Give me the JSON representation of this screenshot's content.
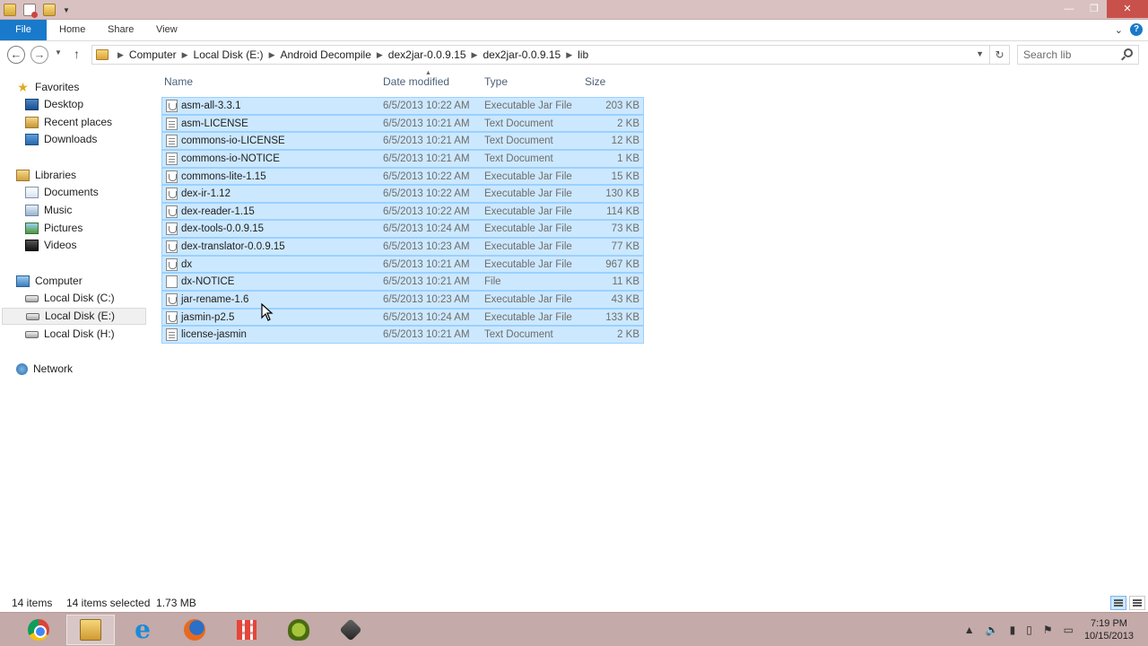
{
  "ribbon": {
    "tabs": [
      "File",
      "Home",
      "Share",
      "View"
    ],
    "accent": "#1979ca"
  },
  "address": {
    "crumbs": [
      "Computer",
      "Local Disk (E:)",
      "Android Decompile",
      "dex2jar-0.0.9.15",
      "dex2jar-0.0.9.15",
      "lib"
    ],
    "search_placeholder": "Search lib"
  },
  "sidebar": {
    "favorites": {
      "label": "Favorites",
      "items": [
        "Desktop",
        "Recent places",
        "Downloads"
      ]
    },
    "libraries": {
      "label": "Libraries",
      "items": [
        "Documents",
        "Music",
        "Pictures",
        "Videos"
      ]
    },
    "computer": {
      "label": "Computer",
      "items": [
        "Local Disk (C:)",
        "Local Disk (E:)",
        "Local Disk (H:)"
      ],
      "selected": "Local Disk (E:)"
    },
    "network": {
      "label": "Network"
    }
  },
  "columns": {
    "name": "Name",
    "date": "Date modified",
    "type": "Type",
    "size": "Size"
  },
  "files": [
    {
      "name": "asm-all-3.3.1",
      "date": "6/5/2013 10:22 AM",
      "type": "Executable Jar File",
      "size": "203 KB",
      "icon": "jar-file-icon"
    },
    {
      "name": "asm-LICENSE",
      "date": "6/5/2013 10:21 AM",
      "type": "Text Document",
      "size": "2 KB",
      "icon": "text-file-icon"
    },
    {
      "name": "commons-io-LICENSE",
      "date": "6/5/2013 10:21 AM",
      "type": "Text Document",
      "size": "12 KB",
      "icon": "text-file-icon"
    },
    {
      "name": "commons-io-NOTICE",
      "date": "6/5/2013 10:21 AM",
      "type": "Text Document",
      "size": "1 KB",
      "icon": "text-file-icon"
    },
    {
      "name": "commons-lite-1.15",
      "date": "6/5/2013 10:22 AM",
      "type": "Executable Jar File",
      "size": "15 KB",
      "icon": "jar-file-icon"
    },
    {
      "name": "dex-ir-1.12",
      "date": "6/5/2013 10:22 AM",
      "type": "Executable Jar File",
      "size": "130 KB",
      "icon": "jar-file-icon"
    },
    {
      "name": "dex-reader-1.15",
      "date": "6/5/2013 10:22 AM",
      "type": "Executable Jar File",
      "size": "114 KB",
      "icon": "jar-file-icon"
    },
    {
      "name": "dex-tools-0.0.9.15",
      "date": "6/5/2013 10:24 AM",
      "type": "Executable Jar File",
      "size": "73 KB",
      "icon": "jar-file-icon"
    },
    {
      "name": "dex-translator-0.0.9.15",
      "date": "6/5/2013 10:23 AM",
      "type": "Executable Jar File",
      "size": "77 KB",
      "icon": "jar-file-icon"
    },
    {
      "name": "dx",
      "date": "6/5/2013 10:21 AM",
      "type": "Executable Jar File",
      "size": "967 KB",
      "icon": "jar-file-icon"
    },
    {
      "name": "dx-NOTICE",
      "date": "6/5/2013 10:21 AM",
      "type": "File",
      "size": "11 KB",
      "icon": "blank-file-icon"
    },
    {
      "name": "jar-rename-1.6",
      "date": "6/5/2013 10:23 AM",
      "type": "Executable Jar File",
      "size": "43 KB",
      "icon": "jar-file-icon"
    },
    {
      "name": "jasmin-p2.5",
      "date": "6/5/2013 10:24 AM",
      "type": "Executable Jar File",
      "size": "133 KB",
      "icon": "jar-file-icon"
    },
    {
      "name": "license-jasmin",
      "date": "6/5/2013 10:21 AM",
      "type": "Text Document",
      "size": "2 KB",
      "icon": "text-file-icon"
    }
  ],
  "status": {
    "count": "14 items",
    "selected": "14 items selected  1.73 MB"
  },
  "taskbar": {
    "apps": [
      "chrome-icon",
      "file-explorer-icon",
      "internet-explorer-icon",
      "firefox-icon",
      "grid-app-icon",
      "android-icon",
      "tool-icon"
    ],
    "time": "7:19 PM",
    "date": "10/15/2013"
  }
}
